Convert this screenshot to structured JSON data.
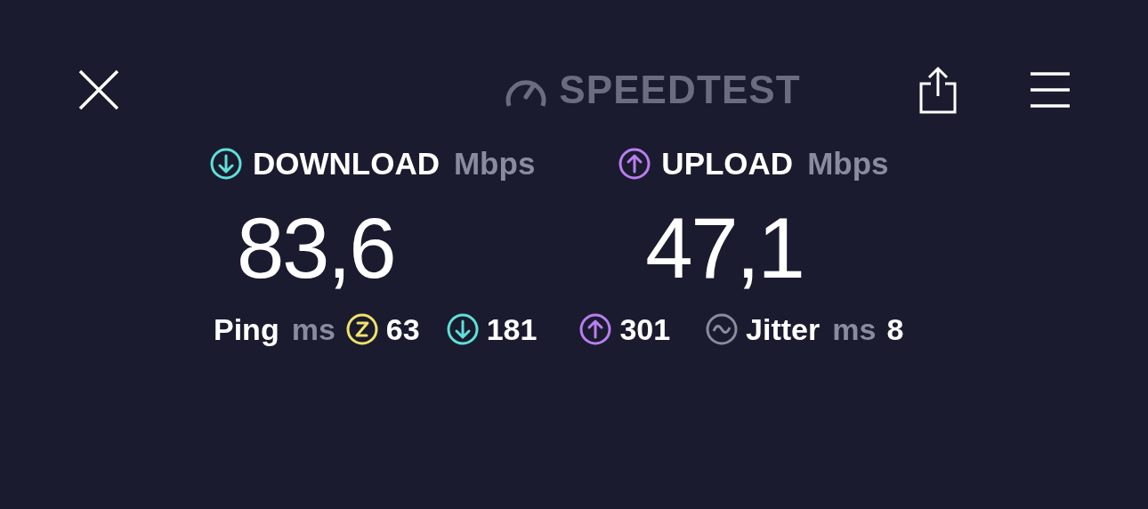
{
  "header": {
    "logo": "SPEEDTEST"
  },
  "results": [
    {
      "kind": "download",
      "label": "DOWNLOAD",
      "unit": "Mbps",
      "value": "83,6",
      "color": "#5fe0d8"
    },
    {
      "kind": "upload",
      "label": "UPLOAD",
      "unit": "Mbps",
      "value": "47,1",
      "color": "#b87ff0"
    }
  ],
  "ping": {
    "label": "Ping",
    "unit": "ms",
    "items": [
      {
        "kind": "idle",
        "value": "63",
        "color": "#f0e26a"
      },
      {
        "kind": "download",
        "value": "181",
        "color": "#5fe0d8"
      },
      {
        "kind": "upload",
        "value": "301",
        "color": "#b87ff0"
      }
    ]
  },
  "jitter": {
    "label": "Jitter",
    "unit": "ms",
    "value": "8"
  }
}
